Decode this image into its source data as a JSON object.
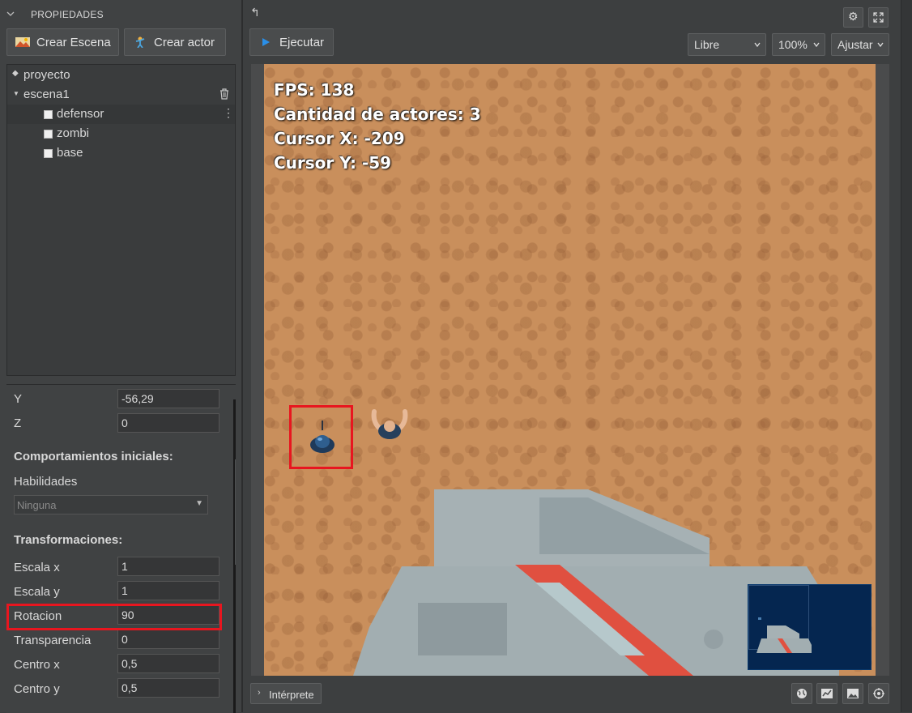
{
  "left_panel": {
    "header_title": "PROPIEDADES",
    "create_scene_label": "Crear Escena",
    "create_actor_label": "Crear actor",
    "tree": {
      "project": "proyecto",
      "scene": "escena1",
      "actors": [
        "defensor",
        "zombi",
        "base"
      ]
    },
    "properties": {
      "y_label": "Y",
      "y_value": "-56,29",
      "z_label": "Z",
      "z_value": "0",
      "behaviors_title": "Comportamientos iniciales:",
      "abilities_label": "Habilidades",
      "abilities_value": "Ninguna",
      "transforms_title": "Transformaciones:",
      "scale_x_label": "Escala x",
      "scale_x_value": "1",
      "scale_y_label": "Escala y",
      "scale_y_value": "1",
      "rotation_label": "Rotacion",
      "rotation_value": "90",
      "transparency_label": "Transparencia",
      "transparency_value": "0",
      "center_x_label": "Centro x",
      "center_x_value": "0,5",
      "center_y_label": "Centro y",
      "center_y_value": "0,5"
    }
  },
  "toolbar": {
    "run_label": "Ejecutar",
    "mode_value": "Libre",
    "zoom_value": "100%",
    "fit_value": "Ajustar"
  },
  "canvas": {
    "fps": "FPS: 138",
    "actor_count": "Cantidad de actores: 3",
    "cursor_x": "Cursor X: -209",
    "cursor_y": "Cursor Y: -59"
  },
  "bottom": {
    "interpreter_label": "Intérprete"
  },
  "colors": {
    "highlight": "#e8161f",
    "run_accent": "#2a8fe8",
    "sand": "#c98f5c"
  }
}
